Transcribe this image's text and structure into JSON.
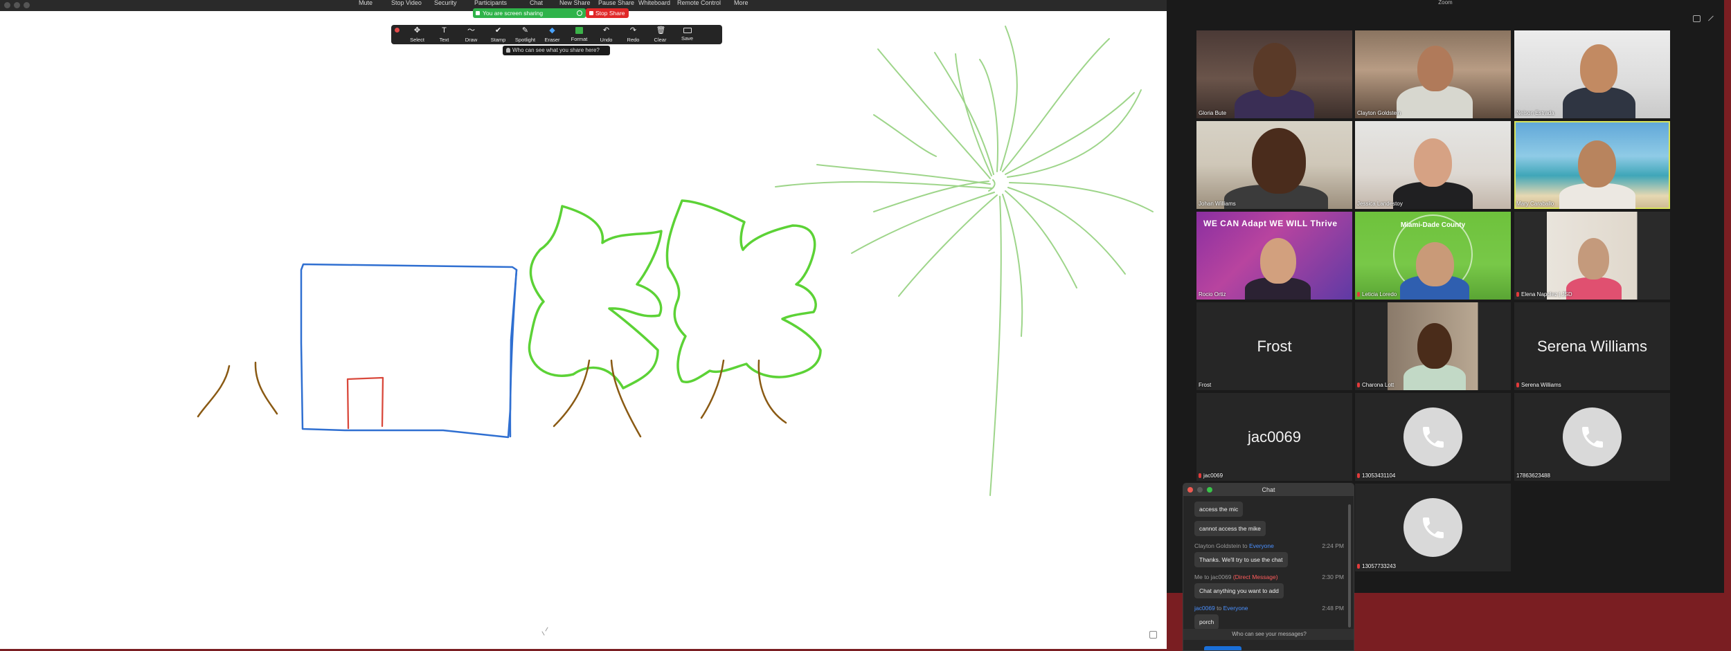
{
  "window": {
    "title": "Zoom"
  },
  "meeting_controls": [
    "Mute",
    "Stop Video",
    "Security",
    "Participants",
    "Chat",
    "New Share",
    "Pause Share",
    "Whiteboard",
    "Remote Control",
    "More"
  ],
  "sharing": {
    "status": "You are screen sharing",
    "stop_label": "Stop Share"
  },
  "annotation": {
    "tools": [
      {
        "label": "Select",
        "icon": "move-icon"
      },
      {
        "label": "Text",
        "icon": "text-icon"
      },
      {
        "label": "Draw",
        "icon": "draw-icon"
      },
      {
        "label": "Stamp",
        "icon": "check-stamp-icon"
      },
      {
        "label": "Spotlight",
        "icon": "spotlight-icon"
      },
      {
        "label": "Eraser",
        "icon": "eraser-icon"
      },
      {
        "label": "Format",
        "icon": "format-icon"
      },
      {
        "label": "Undo",
        "icon": "undo-icon"
      },
      {
        "label": "Redo",
        "icon": "redo-icon"
      },
      {
        "label": "Clear",
        "icon": "trash-icon"
      },
      {
        "label": "Save",
        "icon": "save-icon"
      }
    ],
    "active_tool": "Eraser",
    "who_can_see": "Who can see what you share here?"
  },
  "participants": [
    {
      "name": "Gloria Bute"
    },
    {
      "name": "Clayton Goldstein"
    },
    {
      "name": "Nelson Estrada"
    },
    {
      "name": "Johan Williams"
    },
    {
      "name": "Jessica Landestoy"
    },
    {
      "name": "Mary Caraballo"
    },
    {
      "name": "Rocio Ortiz"
    },
    {
      "name": "Leticia Loredo"
    },
    {
      "name": "Elena Napolez | JSD"
    },
    {
      "name": "Frost",
      "display": "Frost"
    },
    {
      "name": "Charona Lott"
    },
    {
      "name": "Serena Williams",
      "display": "Serena Williams"
    },
    {
      "name": "jac0069",
      "display": "jac0069"
    },
    {
      "name": "13053431104"
    },
    {
      "name": "17863623488"
    },
    {
      "name": "13057733243"
    }
  ],
  "banners": {
    "rocio": "WE CAN Adapt WE WILL Thrive",
    "leticia": "Miami-Dade County"
  },
  "chat": {
    "title": "Chat",
    "messages": [
      {
        "text": "access the mic"
      },
      {
        "text": "cannot access the mike"
      },
      {
        "sender": "Clayton Goldstein",
        "to_word": "to",
        "to": "Everyone",
        "time": "2:24 PM",
        "text": "Thanks.  We'll try to use the chat"
      },
      {
        "sender": "Me",
        "to_word": "to",
        "to": "jac0069",
        "tag": "(Direct Message)",
        "time": "2:30 PM",
        "text": "Chat anything you want to add"
      },
      {
        "sender": "jac0069",
        "to_word": "to",
        "to": "Everyone",
        "time": "2:48 PM",
        "text": "porch"
      }
    ],
    "footer": "Who can see your messages?"
  },
  "colors": {
    "house": "#2f6fd1",
    "door": "#d9483b",
    "tree_canopy": "#5cd236",
    "trunk": "#8a5a14",
    "sun": "#9ed58a",
    "share_green": "#2fb34a",
    "stop_red": "#e02828",
    "active_border": "#d9e45c",
    "desktop": "#7a1e22"
  }
}
